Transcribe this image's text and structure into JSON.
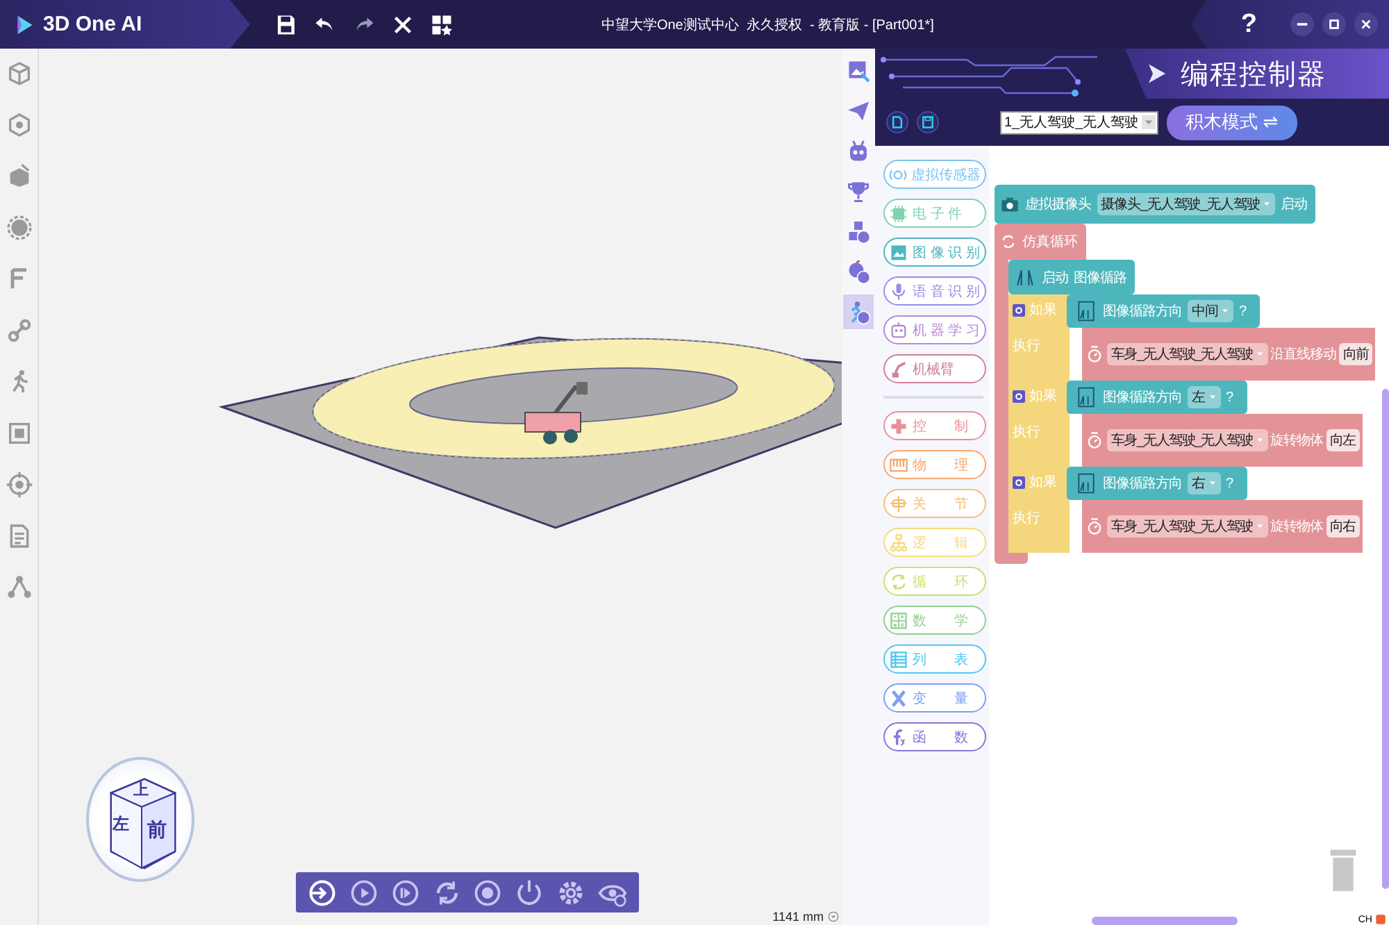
{
  "title_bar": {
    "app_name": "3D One AI",
    "document_title": "中望大学One测试中心  永久授权  - 教育版 - [Part001*]",
    "help": "?"
  },
  "viewport": {
    "view_cube": {
      "top": "上",
      "left": "左",
      "front": "前"
    },
    "scale": "1141 mm"
  },
  "side_tools": [
    {
      "selected": false
    },
    {
      "selected": false
    },
    {
      "selected": false
    },
    {
      "selected": false
    },
    {
      "selected": false
    },
    {
      "selected": false
    },
    {
      "selected": true
    }
  ],
  "panel": {
    "title": "编程控制器",
    "model_select": "1_无人驾驶_无人驾驶",
    "mode_button": "积木模式 ⇌",
    "category_groups": [
      {
        "items": [
          {
            "label": "虚拟传感器",
            "color": "#7cc4f5"
          },
          {
            "label": "电 子 件",
            "color": "#7fd3b0"
          },
          {
            "label": "图 像 识 别",
            "color": "#4cb8c0"
          },
          {
            "label": "语 音 识 别",
            "color": "#9a8ee8"
          },
          {
            "label": "机 器 学 习",
            "color": "#b888d8"
          },
          {
            "label": "机械臂",
            "color": "#d080a0"
          }
        ]
      },
      {
        "items": [
          {
            "label": "控　　制",
            "color": "#e8909a"
          },
          {
            "label": "物　　理",
            "color": "#f5a870"
          },
          {
            "label": "关　　节",
            "color": "#f5c070"
          },
          {
            "label": "逻　　辑",
            "color": "#f5dc80"
          },
          {
            "label": "循　　环",
            "color": "#c8e070"
          },
          {
            "label": "数　　学",
            "color": "#90d090"
          },
          {
            "label": "列　　表",
            "color": "#50c8f0"
          },
          {
            "label": "变　　量",
            "color": "#80a0f0"
          },
          {
            "label": "函　　数",
            "color": "#8878d8"
          }
        ]
      }
    ],
    "workspace": {
      "camera_block": {
        "label": "虚拟摄像头",
        "camera": "摄像头_无人驾驶_无人驾驶",
        "action": "启动"
      },
      "loop_block": {
        "label": "仿真循环"
      },
      "start_block": {
        "action": "启动",
        "label": "图像循路"
      },
      "if_blocks": [
        {
          "if_label": "如果",
          "condition": "图像循路方向",
          "direction": "中间",
          "question": "?",
          "do_label": "执行",
          "target": "车身_无人驾驶_无人驾驶",
          "action": "沿直线移动",
          "value": "向前"
        },
        {
          "if_label": "如果",
          "condition": "图像循路方向",
          "direction": "左",
          "question": "?",
          "do_label": "执行",
          "target": "车身_无人驾驶_无人驾驶",
          "action": "旋转物体",
          "value": "向左"
        },
        {
          "if_label": "如果",
          "condition": "图像循路方向",
          "direction": "右",
          "question": "?",
          "do_label": "执行",
          "target": "车身_无人驾驶_无人驾驶",
          "action": "旋转物体",
          "value": "向右"
        }
      ]
    }
  },
  "status": {
    "input_method": "CH"
  }
}
